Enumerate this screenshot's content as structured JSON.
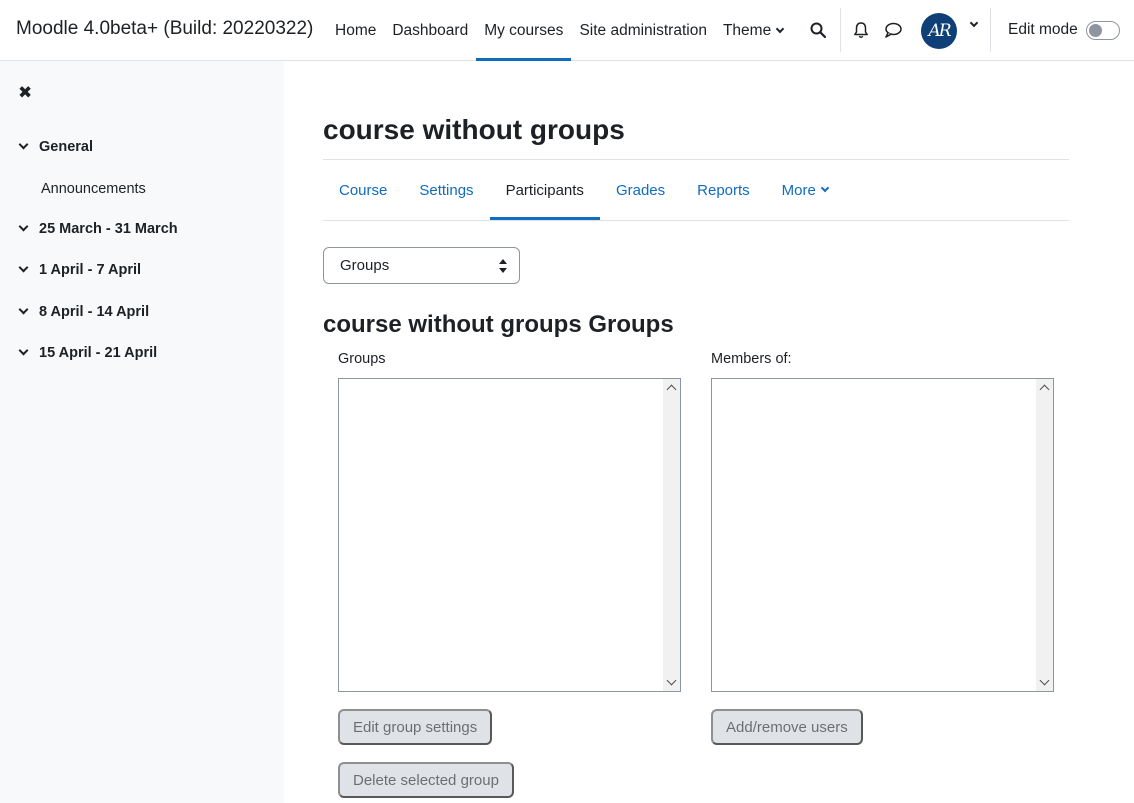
{
  "site": {
    "brand": "Moodle 4.0beta+ (Build: 20220322)"
  },
  "primary_nav": [
    {
      "label": "Home"
    },
    {
      "label": "Dashboard"
    },
    {
      "label": "My courses",
      "active": true
    },
    {
      "label": "Site administration"
    },
    {
      "label": "Theme",
      "dropdown": true
    }
  ],
  "user": {
    "avatar_initials": "AR",
    "edit_mode_label": "Edit mode",
    "edit_mode_on": false
  },
  "drawer": {
    "sections": [
      {
        "title": "General",
        "activities": [
          "Announcements"
        ]
      },
      {
        "title": "25 March - 31 March"
      },
      {
        "title": "1 April - 7 April"
      },
      {
        "title": "8 April - 14 April"
      },
      {
        "title": "15 April - 21 April"
      }
    ]
  },
  "course": {
    "title": "course without groups"
  },
  "secondary_nav": [
    {
      "label": "Course"
    },
    {
      "label": "Settings"
    },
    {
      "label": "Participants",
      "active": true
    },
    {
      "label": "Grades"
    },
    {
      "label": "Reports"
    },
    {
      "label": "More",
      "dropdown": true
    }
  ],
  "groups_page": {
    "select_value": "Groups",
    "heading": "course without groups Groups",
    "groups_label": "Groups",
    "members_label": "Members of:",
    "edit_group_settings": "Edit group settings",
    "delete_selected_group": "Delete selected group",
    "add_remove_users": "Add/remove users"
  },
  "colors": {
    "accent": "#0f6cbf",
    "drawer_bg": "#f8f9fa",
    "avatar_bg": "#0e3f77"
  }
}
